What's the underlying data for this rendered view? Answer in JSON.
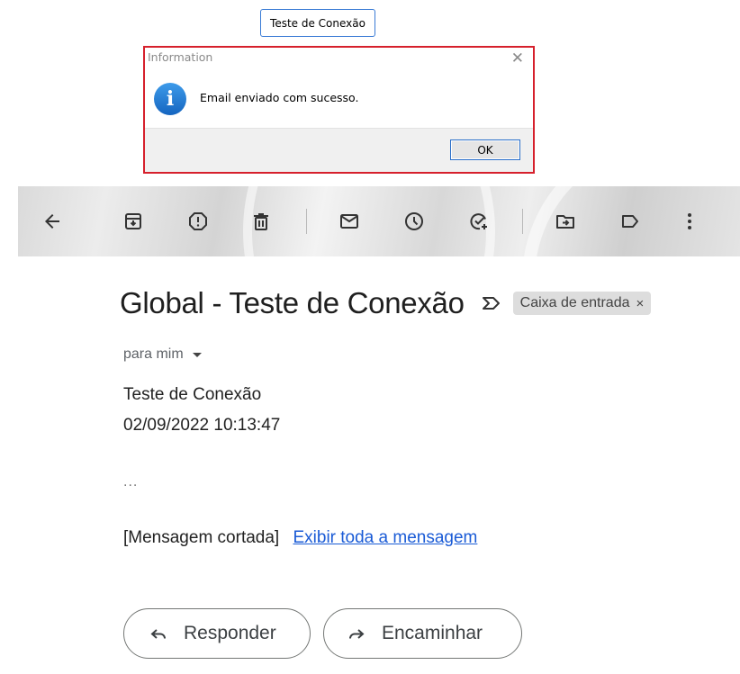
{
  "test_button": {
    "label": "Teste de Conexão"
  },
  "dialog": {
    "title": "Information",
    "close_symbol": "✕",
    "icon": "info-icon",
    "message": "Email enviado com sucesso.",
    "ok_label": "OK"
  },
  "toolbar": {
    "icons": [
      "back-arrow-icon",
      "archive-icon",
      "report-spam-icon",
      "delete-icon",
      "mark-unread-icon",
      "snooze-icon",
      "add-task-icon",
      "move-to-icon",
      "label-icon",
      "more-options-icon"
    ]
  },
  "email": {
    "subject": "Global - Teste de Conexão",
    "label_chip": "Caixa de entrada",
    "label_chip_close": "×",
    "recipient": "para mim",
    "body_line1": "Teste de Conexão",
    "body_line2": "02/09/2022 10:13:47",
    "ellipsis": "...",
    "clipped_text": "[Mensagem cortada]",
    "view_full_link": "Exibir toda a mensagem",
    "reply_label": "Responder",
    "forward_label": "Encaminhar"
  },
  "colors": {
    "dialog_highlight": "#d6202c",
    "link": "#1a5bd6",
    "info_blue": "#1976d2"
  }
}
